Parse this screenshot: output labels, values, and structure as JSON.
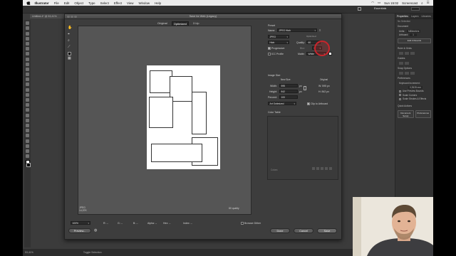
{
  "menubar": {
    "items": [
      "Illustrator",
      "File",
      "Edit",
      "Object",
      "Type",
      "Select",
      "Effect",
      "View",
      "Window",
      "Help"
    ],
    "clock": "Sun 15:02",
    "app_label": "Screencast"
  },
  "appbar": {
    "workspace": "Essentials"
  },
  "document_tab": "Untitled-4* @ 53,41%",
  "right_panel": {
    "tabs": [
      "Properties",
      "Layers",
      "Libraries"
    ],
    "no_selection": "No Selection",
    "document": "Document",
    "units_label": "Units:",
    "units_value": "Millimeters",
    "artboard_label": "Artboard:",
    "artboard_value": "1",
    "edit_artboards": "Edit Artboards",
    "rulers_grids": "Ruler & Grids",
    "guides": "Guides",
    "snap_options": "Snap Options",
    "preferences": "Preferences",
    "keyboard_increment_label": "Keyboard Increment:",
    "keyboard_increment_value": "0,3528 mm",
    "use_preview_bounds": "Use Preview Bounds",
    "scale_corners": "Scale Corners",
    "scale_strokes": "Scale Strokes & Effects",
    "quick_actions": "Quick Actions",
    "document_setup": "Document Setup",
    "preferences_btn": "Preferences"
  },
  "status_bar": {
    "zoom": "53,41%",
    "toggle": "Toggle Selection"
  },
  "dialog": {
    "title": "Save for Web (Legacy)",
    "view_tabs": [
      "Original",
      "Optimized",
      "2-Up"
    ],
    "active_view": "Optimized",
    "preview_info": {
      "format": "JPEG",
      "size": "14,57K",
      "quality": "80 quality"
    },
    "preset_label": "Preset",
    "name_label": "Name:",
    "preset_value": "JPEG High",
    "format_value": "JPEG",
    "quality_level": "High",
    "quality_label": "Quality:",
    "quality_value": "60",
    "optimized_label": "Optimized",
    "blur_label": "Blur:",
    "blur_value": "0",
    "progressive_label": "Progressive",
    "progressive_checked": true,
    "icc_label": "ICC Profile",
    "icc_checked": false,
    "matte_label": "Matte:",
    "matte_value": "White",
    "image_size_label": "Image Size",
    "new_size_label": "New Size",
    "original_label": "Original",
    "width_label": "Width:",
    "width_value": "595",
    "width_original": "W: 595 px",
    "height_label": "Height:",
    "height_value": "842",
    "height_original": "H: 842 px",
    "unit_px": "px",
    "percent_label": "Percent:",
    "percent_value": "100",
    "resample_value": "Art Optimized",
    "clip_label": "Clip to Artboard",
    "clip_checked": true,
    "color_table_label": "Color Table",
    "colors_label": "Colors:",
    "zoom_value": "100%",
    "readouts": [
      "R: --",
      "G: --",
      "B: --",
      "Alpha: --",
      "Hex: --",
      "Index: --"
    ],
    "browser_dither": "Browser Dither",
    "preview_button": "Preview...",
    "done_button": "Done",
    "cancel_button": "Cancel",
    "save_button": "Save"
  }
}
